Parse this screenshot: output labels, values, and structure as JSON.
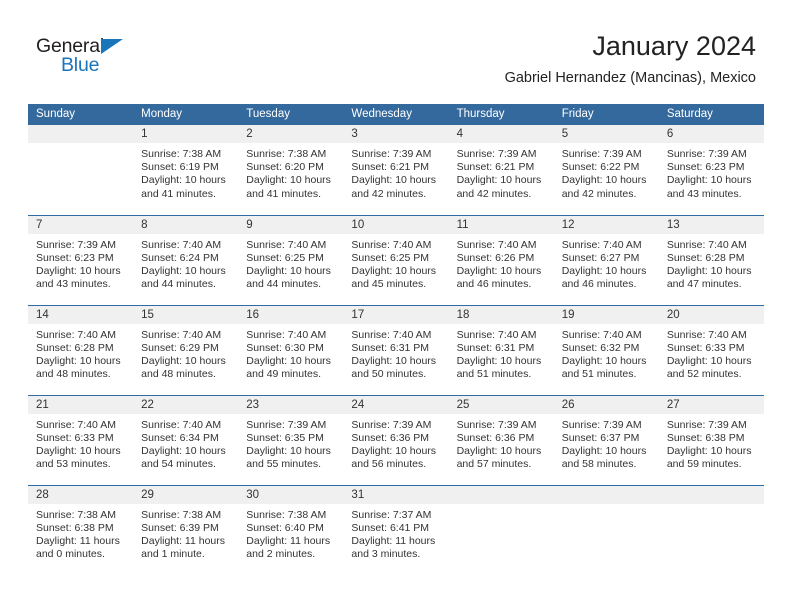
{
  "brand": {
    "name_part1": "General",
    "name_part2": "Blue",
    "accent_color": "#1b75bb",
    "triangle_icon": "logo-triangle-icon"
  },
  "header": {
    "title": "January 2024",
    "subtitle": "Gabriel Hernandez (Mancinas), Mexico"
  },
  "colors": {
    "header_row_bg": "#34699d",
    "header_row_text": "#ffffff",
    "daynum_bg": "#f0f0f0",
    "row_divider": "#2b6ca3",
    "body_text": "#333333"
  },
  "calendar": {
    "weekday_headers": [
      "Sunday",
      "Monday",
      "Tuesday",
      "Wednesday",
      "Thursday",
      "Friday",
      "Saturday"
    ],
    "weeks": [
      [
        {
          "day": "",
          "empty": true
        },
        {
          "day": "1",
          "sunrise": "Sunrise: 7:38 AM",
          "sunset": "Sunset: 6:19 PM",
          "daylight_line1": "Daylight: 10 hours",
          "daylight_line2": "and 41 minutes."
        },
        {
          "day": "2",
          "sunrise": "Sunrise: 7:38 AM",
          "sunset": "Sunset: 6:20 PM",
          "daylight_line1": "Daylight: 10 hours",
          "daylight_line2": "and 41 minutes."
        },
        {
          "day": "3",
          "sunrise": "Sunrise: 7:39 AM",
          "sunset": "Sunset: 6:21 PM",
          "daylight_line1": "Daylight: 10 hours",
          "daylight_line2": "and 42 minutes."
        },
        {
          "day": "4",
          "sunrise": "Sunrise: 7:39 AM",
          "sunset": "Sunset: 6:21 PM",
          "daylight_line1": "Daylight: 10 hours",
          "daylight_line2": "and 42 minutes."
        },
        {
          "day": "5",
          "sunrise": "Sunrise: 7:39 AM",
          "sunset": "Sunset: 6:22 PM",
          "daylight_line1": "Daylight: 10 hours",
          "daylight_line2": "and 42 minutes."
        },
        {
          "day": "6",
          "sunrise": "Sunrise: 7:39 AM",
          "sunset": "Sunset: 6:23 PM",
          "daylight_line1": "Daylight: 10 hours",
          "daylight_line2": "and 43 minutes."
        }
      ],
      [
        {
          "day": "7",
          "sunrise": "Sunrise: 7:39 AM",
          "sunset": "Sunset: 6:23 PM",
          "daylight_line1": "Daylight: 10 hours",
          "daylight_line2": "and 43 minutes."
        },
        {
          "day": "8",
          "sunrise": "Sunrise: 7:40 AM",
          "sunset": "Sunset: 6:24 PM",
          "daylight_line1": "Daylight: 10 hours",
          "daylight_line2": "and 44 minutes."
        },
        {
          "day": "9",
          "sunrise": "Sunrise: 7:40 AM",
          "sunset": "Sunset: 6:25 PM",
          "daylight_line1": "Daylight: 10 hours",
          "daylight_line2": "and 44 minutes."
        },
        {
          "day": "10",
          "sunrise": "Sunrise: 7:40 AM",
          "sunset": "Sunset: 6:25 PM",
          "daylight_line1": "Daylight: 10 hours",
          "daylight_line2": "and 45 minutes."
        },
        {
          "day": "11",
          "sunrise": "Sunrise: 7:40 AM",
          "sunset": "Sunset: 6:26 PM",
          "daylight_line1": "Daylight: 10 hours",
          "daylight_line2": "and 46 minutes."
        },
        {
          "day": "12",
          "sunrise": "Sunrise: 7:40 AM",
          "sunset": "Sunset: 6:27 PM",
          "daylight_line1": "Daylight: 10 hours",
          "daylight_line2": "and 46 minutes."
        },
        {
          "day": "13",
          "sunrise": "Sunrise: 7:40 AM",
          "sunset": "Sunset: 6:28 PM",
          "daylight_line1": "Daylight: 10 hours",
          "daylight_line2": "and 47 minutes."
        }
      ],
      [
        {
          "day": "14",
          "sunrise": "Sunrise: 7:40 AM",
          "sunset": "Sunset: 6:28 PM",
          "daylight_line1": "Daylight: 10 hours",
          "daylight_line2": "and 48 minutes."
        },
        {
          "day": "15",
          "sunrise": "Sunrise: 7:40 AM",
          "sunset": "Sunset: 6:29 PM",
          "daylight_line1": "Daylight: 10 hours",
          "daylight_line2": "and 48 minutes."
        },
        {
          "day": "16",
          "sunrise": "Sunrise: 7:40 AM",
          "sunset": "Sunset: 6:30 PM",
          "daylight_line1": "Daylight: 10 hours",
          "daylight_line2": "and 49 minutes."
        },
        {
          "day": "17",
          "sunrise": "Sunrise: 7:40 AM",
          "sunset": "Sunset: 6:31 PM",
          "daylight_line1": "Daylight: 10 hours",
          "daylight_line2": "and 50 minutes."
        },
        {
          "day": "18",
          "sunrise": "Sunrise: 7:40 AM",
          "sunset": "Sunset: 6:31 PM",
          "daylight_line1": "Daylight: 10 hours",
          "daylight_line2": "and 51 minutes."
        },
        {
          "day": "19",
          "sunrise": "Sunrise: 7:40 AM",
          "sunset": "Sunset: 6:32 PM",
          "daylight_line1": "Daylight: 10 hours",
          "daylight_line2": "and 51 minutes."
        },
        {
          "day": "20",
          "sunrise": "Sunrise: 7:40 AM",
          "sunset": "Sunset: 6:33 PM",
          "daylight_line1": "Daylight: 10 hours",
          "daylight_line2": "and 52 minutes."
        }
      ],
      [
        {
          "day": "21",
          "sunrise": "Sunrise: 7:40 AM",
          "sunset": "Sunset: 6:33 PM",
          "daylight_line1": "Daylight: 10 hours",
          "daylight_line2": "and 53 minutes."
        },
        {
          "day": "22",
          "sunrise": "Sunrise: 7:40 AM",
          "sunset": "Sunset: 6:34 PM",
          "daylight_line1": "Daylight: 10 hours",
          "daylight_line2": "and 54 minutes."
        },
        {
          "day": "23",
          "sunrise": "Sunrise: 7:39 AM",
          "sunset": "Sunset: 6:35 PM",
          "daylight_line1": "Daylight: 10 hours",
          "daylight_line2": "and 55 minutes."
        },
        {
          "day": "24",
          "sunrise": "Sunrise: 7:39 AM",
          "sunset": "Sunset: 6:36 PM",
          "daylight_line1": "Daylight: 10 hours",
          "daylight_line2": "and 56 minutes."
        },
        {
          "day": "25",
          "sunrise": "Sunrise: 7:39 AM",
          "sunset": "Sunset: 6:36 PM",
          "daylight_line1": "Daylight: 10 hours",
          "daylight_line2": "and 57 minutes."
        },
        {
          "day": "26",
          "sunrise": "Sunrise: 7:39 AM",
          "sunset": "Sunset: 6:37 PM",
          "daylight_line1": "Daylight: 10 hours",
          "daylight_line2": "and 58 minutes."
        },
        {
          "day": "27",
          "sunrise": "Sunrise: 7:39 AM",
          "sunset": "Sunset: 6:38 PM",
          "daylight_line1": "Daylight: 10 hours",
          "daylight_line2": "and 59 minutes."
        }
      ],
      [
        {
          "day": "28",
          "sunrise": "Sunrise: 7:38 AM",
          "sunset": "Sunset: 6:38 PM",
          "daylight_line1": "Daylight: 11 hours",
          "daylight_line2": "and 0 minutes."
        },
        {
          "day": "29",
          "sunrise": "Sunrise: 7:38 AM",
          "sunset": "Sunset: 6:39 PM",
          "daylight_line1": "Daylight: 11 hours",
          "daylight_line2": "and 1 minute."
        },
        {
          "day": "30",
          "sunrise": "Sunrise: 7:38 AM",
          "sunset": "Sunset: 6:40 PM",
          "daylight_line1": "Daylight: 11 hours",
          "daylight_line2": "and 2 minutes."
        },
        {
          "day": "31",
          "sunrise": "Sunrise: 7:37 AM",
          "sunset": "Sunset: 6:41 PM",
          "daylight_line1": "Daylight: 11 hours",
          "daylight_line2": "and 3 minutes."
        },
        {
          "day": "",
          "empty": true
        },
        {
          "day": "",
          "empty": true
        },
        {
          "day": "",
          "empty": true
        }
      ]
    ]
  }
}
